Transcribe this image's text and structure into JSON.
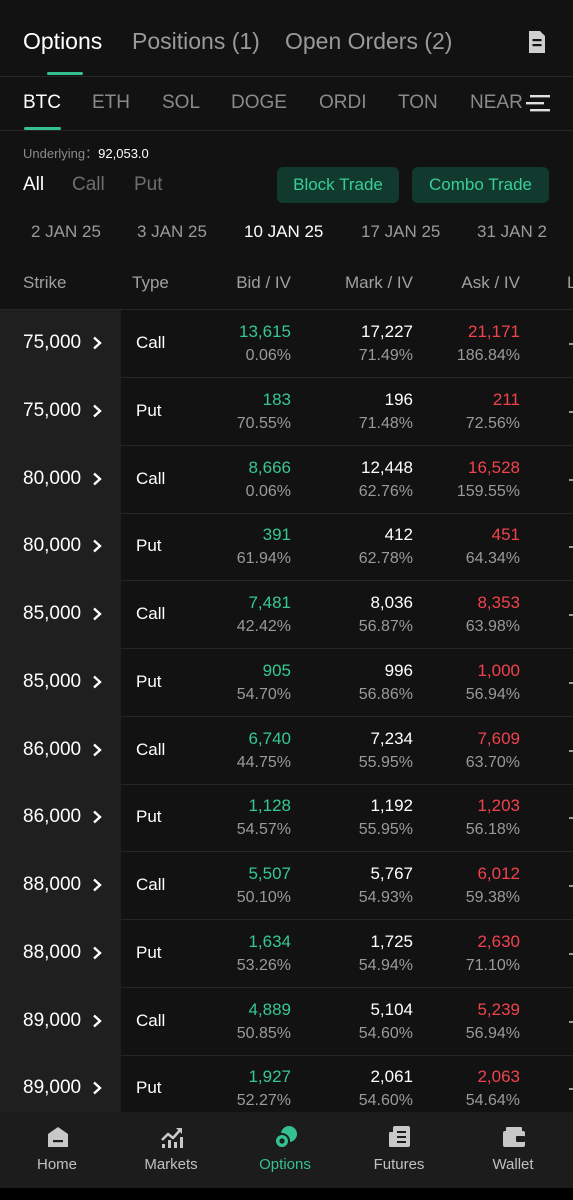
{
  "top_tabs": [
    {
      "label": "Options"
    },
    {
      "label": "Positions (1)"
    },
    {
      "label": "Open Orders (2)"
    }
  ],
  "coins": [
    "BTC",
    "ETH",
    "SOL",
    "DOGE",
    "ORDI",
    "TON",
    "NEAR"
  ],
  "underlying": {
    "label": "Underlying：",
    "value": "92,053.0"
  },
  "filters": [
    "All",
    "Call",
    "Put"
  ],
  "buttons": {
    "block_trade": "Block Trade",
    "combo_trade": "Combo Trade"
  },
  "dates": [
    "2 JAN 25",
    "3 JAN 25",
    "10 JAN 25",
    "17 JAN 25",
    "31 JAN 2"
  ],
  "columns": {
    "strike": "Strike",
    "type": "Type",
    "bid": "Bid / IV",
    "mark": "Mark / IV",
    "ask": "Ask / IV",
    "extra": "L"
  },
  "rows": [
    {
      "strike": "75,000",
      "type": "Call",
      "bid": "13,615",
      "bid_iv": "0.06%",
      "mark": "17,227",
      "mark_iv": "71.49%",
      "ask": "21,171",
      "ask_iv": "186.84%"
    },
    {
      "strike": "75,000",
      "type": "Put",
      "bid": "183",
      "bid_iv": "70.55%",
      "mark": "196",
      "mark_iv": "71.48%",
      "ask": "211",
      "ask_iv": "72.56%"
    },
    {
      "strike": "80,000",
      "type": "Call",
      "bid": "8,666",
      "bid_iv": "0.06%",
      "mark": "12,448",
      "mark_iv": "62.76%",
      "ask": "16,528",
      "ask_iv": "159.55%"
    },
    {
      "strike": "80,000",
      "type": "Put",
      "bid": "391",
      "bid_iv": "61.94%",
      "mark": "412",
      "mark_iv": "62.78%",
      "ask": "451",
      "ask_iv": "64.34%"
    },
    {
      "strike": "85,000",
      "type": "Call",
      "bid": "7,481",
      "bid_iv": "42.42%",
      "mark": "8,036",
      "mark_iv": "56.87%",
      "ask": "8,353",
      "ask_iv": "63.98%"
    },
    {
      "strike": "85,000",
      "type": "Put",
      "bid": "905",
      "bid_iv": "54.70%",
      "mark": "996",
      "mark_iv": "56.86%",
      "ask": "1,000",
      "ask_iv": "56.94%"
    },
    {
      "strike": "86,000",
      "type": "Call",
      "bid": "6,740",
      "bid_iv": "44.75%",
      "mark": "7,234",
      "mark_iv": "55.95%",
      "ask": "7,609",
      "ask_iv": "63.70%"
    },
    {
      "strike": "86,000",
      "type": "Put",
      "bid": "1,128",
      "bid_iv": "54.57%",
      "mark": "1,192",
      "mark_iv": "55.95%",
      "ask": "1,203",
      "ask_iv": "56.18%"
    },
    {
      "strike": "88,000",
      "type": "Call",
      "bid": "5,507",
      "bid_iv": "50.10%",
      "mark": "5,767",
      "mark_iv": "54.93%",
      "ask": "6,012",
      "ask_iv": "59.38%"
    },
    {
      "strike": "88,000",
      "type": "Put",
      "bid": "1,634",
      "bid_iv": "53.26%",
      "mark": "1,725",
      "mark_iv": "54.94%",
      "ask": "2,630",
      "ask_iv": "71.10%"
    },
    {
      "strike": "89,000",
      "type": "Call",
      "bid": "4,889",
      "bid_iv": "50.85%",
      "mark": "5,104",
      "mark_iv": "54.60%",
      "ask": "5,239",
      "ask_iv": "56.94%"
    },
    {
      "strike": "89,000",
      "type": "Put",
      "bid": "1,927",
      "bid_iv": "52.27%",
      "mark": "2,061",
      "mark_iv": "54.60%",
      "ask": "2,063",
      "ask_iv": "54.64%"
    }
  ],
  "nav": [
    {
      "label": "Home",
      "icon": "home-icon"
    },
    {
      "label": "Markets",
      "icon": "markets-icon"
    },
    {
      "label": "Options",
      "icon": "options-icon"
    },
    {
      "label": "Futures",
      "icon": "futures-icon"
    },
    {
      "label": "Wallet",
      "icon": "wallet-icon"
    }
  ],
  "colors": {
    "accent": "#33c28f",
    "bid": "#36c891",
    "ask": "#f0434c",
    "pill_bg": "#12392e"
  }
}
